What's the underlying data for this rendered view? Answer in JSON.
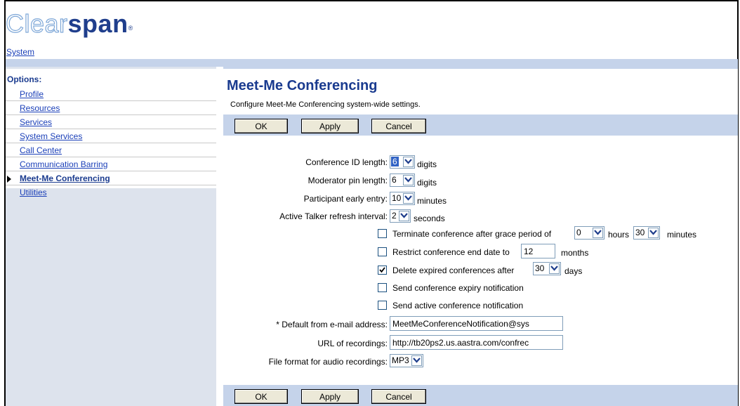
{
  "logo": {
    "part1": "Clear",
    "part2": "span",
    "reg": "®"
  },
  "nav": {
    "system_link": "System"
  },
  "sidebar": {
    "title": "Options:",
    "items": [
      {
        "label": "Profile"
      },
      {
        "label": "Resources"
      },
      {
        "label": "Services"
      },
      {
        "label": "System Services"
      },
      {
        "label": "Call Center"
      },
      {
        "label": "Communication Barring"
      },
      {
        "label": "Meet-Me Conferencing",
        "active": true
      },
      {
        "label": "Utilities"
      }
    ]
  },
  "page": {
    "title": "Meet-Me Conferencing",
    "subtitle": "Configure Meet-Me Conferencing system-wide settings."
  },
  "buttons": {
    "ok": "OK",
    "apply": "Apply",
    "cancel": "Cancel"
  },
  "form": {
    "conference_id_length": {
      "label": "Conference ID length:",
      "value": "6",
      "unit": "digits"
    },
    "moderator_pin_length": {
      "label": "Moderator pin length:",
      "value": "6",
      "unit": "digits"
    },
    "participant_early_entry": {
      "label": "Participant early entry:",
      "value": "10",
      "unit": "minutes"
    },
    "active_talker_refresh": {
      "label": "Active Talker refresh interval:",
      "value": "2",
      "unit": "seconds"
    },
    "terminate_conference": {
      "label": "Terminate conference after grace period of",
      "checked": false,
      "hours_value": "0",
      "hours_unit": "hours",
      "minutes_value": "30",
      "minutes_unit": "minutes"
    },
    "restrict_end_date": {
      "label": "Restrict conference end date to",
      "checked": false,
      "value": "12",
      "unit": "months"
    },
    "delete_expired": {
      "label": "Delete expired conferences after",
      "checked": true,
      "value": "30",
      "unit": "days"
    },
    "send_expiry_notification": {
      "label": "Send conference expiry notification",
      "checked": false
    },
    "send_active_notification": {
      "label": "Send active conference notification",
      "checked": false
    },
    "default_from_email": {
      "label": "* Default from e-mail address:",
      "value": "MeetMeConferenceNotification@sys"
    },
    "url_of_recordings": {
      "label": "URL of recordings:",
      "value": "http://tb20ps2.us.aastra.com/confrec"
    },
    "audio_file_format": {
      "label": "File format for audio recordings:",
      "value": "MP3"
    }
  }
}
